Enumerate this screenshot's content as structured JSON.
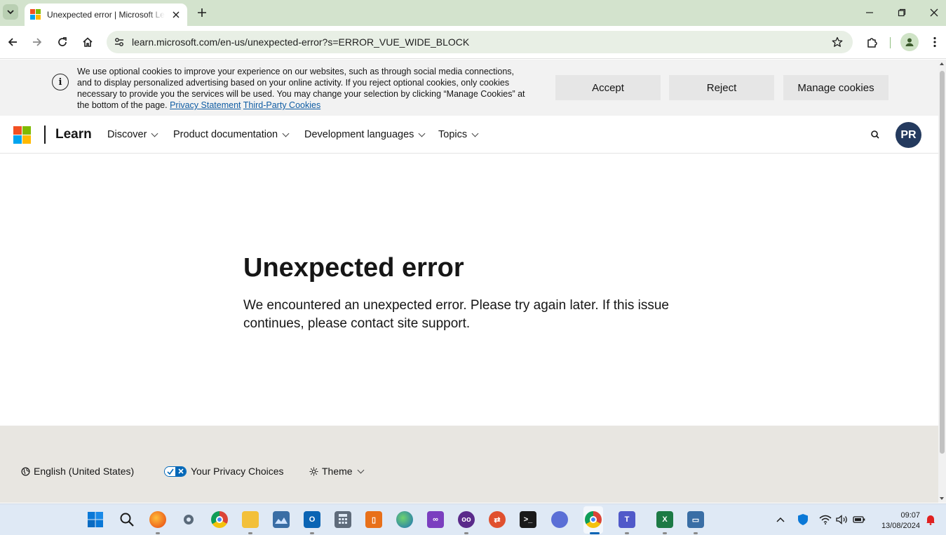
{
  "browser": {
    "tab_title": "Unexpected error | Microsoft Learn",
    "url": "learn.microsoft.com/en-us/unexpected-error?s=ERROR_VUE_WIDE_BLOCK"
  },
  "cookie_banner": {
    "text": "We use optional cookies to improve your experience on our websites, such as through social media connections, and to display personalized advertising based on your online activity. If you reject optional cookies, only cookies necessary to provide you the services will be used. You may change your selection by clicking “Manage Cookies” at the bottom of the page.",
    "privacy_link": "Privacy Statement",
    "third_party_link": "Third-Party Cookies",
    "accept_label": "Accept",
    "reject_label": "Reject",
    "manage_label": "Manage cookies"
  },
  "header": {
    "brand": "Learn",
    "nav": [
      "Discover",
      "Product documentation",
      "Development languages",
      "Topics"
    ],
    "avatar_initials": "PR"
  },
  "main": {
    "title": "Unexpected error",
    "message": "We encountered an unexpected error. Please try again later. If this issue continues, please contact site support."
  },
  "footer": {
    "language": "English (United States)",
    "privacy_choices": "Your Privacy Choices",
    "theme": "Theme"
  },
  "taskbar": {
    "time": "09:07",
    "date": "13/08/2024"
  },
  "colors": {
    "ms_red": "#f25022",
    "ms_green": "#7fba00",
    "ms_blue": "#00a4ef",
    "ms_yellow": "#ffb900",
    "avatar_bg": "#243a5e",
    "link": "#0f5ca3"
  }
}
